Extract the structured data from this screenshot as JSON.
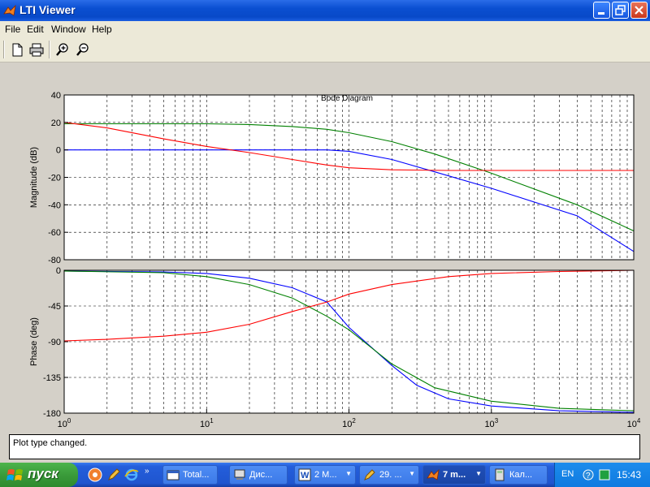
{
  "window": {
    "title": "LTI Viewer"
  },
  "menu": [
    "File",
    "Edit",
    "Window",
    "Help"
  ],
  "status": {
    "text": "Plot type changed."
  },
  "taskbar": {
    "start_label": "пуск",
    "tasks": [
      {
        "label": "Total...",
        "icon": "folder-icon",
        "active": false,
        "arrow": false
      },
      {
        "label": "Дис...",
        "icon": "computer-icon",
        "active": false,
        "arrow": false
      },
      {
        "label": "2 M...",
        "icon": "word-icon",
        "active": false,
        "arrow": true
      },
      {
        "label": "29. ...",
        "icon": "pencil-icon",
        "active": false,
        "arrow": true
      },
      {
        "label": "7 m...",
        "icon": "matlab-icon",
        "active": true,
        "arrow": true
      },
      {
        "label": "Кал...",
        "icon": "calculator-icon",
        "active": false,
        "arrow": false
      }
    ],
    "lang": "EN",
    "clock": "15:43"
  },
  "colors": {
    "blue": "#0000ff",
    "green": "#008000",
    "red": "#ff0000"
  },
  "chart_data": {
    "type": "line",
    "title": "Bode Diagram",
    "xscale": "log",
    "xlim": [
      1,
      10000
    ],
    "xticks": [
      {
        "base": "10",
        "exp": "0"
      },
      {
        "base": "10",
        "exp": "1"
      },
      {
        "base": "10",
        "exp": "2"
      },
      {
        "base": "10",
        "exp": "3"
      },
      {
        "base": "10",
        "exp": "4"
      }
    ],
    "grid": true,
    "panels": [
      {
        "ylabel": "Magnitude (dB)",
        "ylim": [
          -80,
          40
        ],
        "yticks": [
          40,
          20,
          0,
          -20,
          -40,
          -60,
          -80
        ],
        "series": [
          {
            "color": "#0000ff",
            "x": [
              1,
              10,
              40,
              70,
              100,
              200,
              400,
              1000,
              4000,
              10000
            ],
            "y": [
              0,
              0,
              0,
              0,
              -1,
              -7,
              -16,
              -28,
              -48,
              -74
            ]
          },
          {
            "color": "#008000",
            "x": [
              1,
              10,
              20,
              40,
              70,
              100,
              200,
              400,
              1000,
              4000,
              10000
            ],
            "y": [
              19,
              19,
              18.5,
              17,
              15,
              12.5,
              6,
              -3,
              -17,
              -40,
              -59
            ]
          },
          {
            "color": "#ff0000",
            "x": [
              1,
              2,
              5,
              10,
              20,
              40,
              70,
              100,
              200,
              500,
              1000,
              10000
            ],
            "y": [
              20,
              16,
              8,
              2.5,
              -2,
              -7,
              -11,
              -13,
              -14.5,
              -15,
              -15,
              -15
            ]
          }
        ]
      },
      {
        "ylabel": "Phase (deg)",
        "ylim": [
          -180,
          0
        ],
        "yticks": [
          0,
          -45,
          -90,
          -135,
          -180
        ],
        "series": [
          {
            "color": "#0000ff",
            "x": [
              1,
              5,
              10,
              20,
              40,
              70,
              100,
              150,
              200,
              300,
              500,
              1000,
              3000,
              10000
            ],
            "y": [
              -1,
              -2,
              -4,
              -10,
              -22,
              -40,
              -72,
              -100,
              -120,
              -145,
              -162,
              -171,
              -177,
              -179
            ]
          },
          {
            "color": "#008000",
            "x": [
              1,
              5,
              10,
              20,
              40,
              70,
              100,
              200,
              400,
              1000,
              3000,
              10000
            ],
            "y": [
              -1,
              -3,
              -8,
              -18,
              -35,
              -58,
              -75,
              -118,
              -148,
              -165,
              -174,
              -177
            ]
          },
          {
            "color": "#ff0000",
            "x": [
              1,
              2,
              5,
              10,
              20,
              40,
              70,
              100,
              200,
              500,
              1000,
              3000,
              10000
            ],
            "y": [
              -89,
              -87,
              -83,
              -78,
              -68,
              -52,
              -40,
              -30,
              -18,
              -8,
              -4,
              -1.5,
              0
            ]
          }
        ]
      }
    ]
  }
}
